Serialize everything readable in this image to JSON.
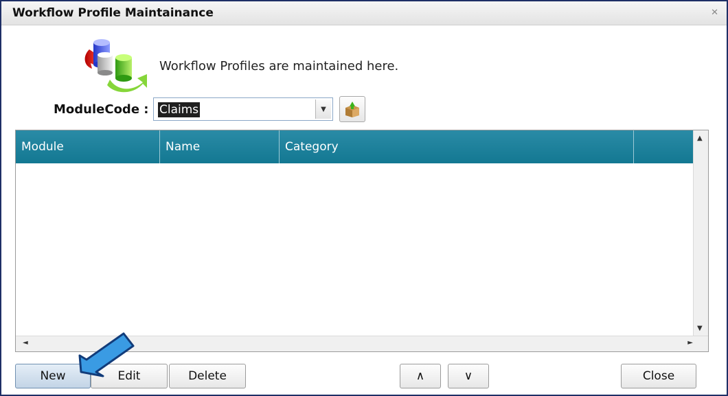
{
  "window": {
    "title": "Workflow Profile Maintainance",
    "close_glyph": "✕"
  },
  "header": {
    "description": "Workflow Profiles are maintained here.",
    "logo_icon": "database-sync-icon"
  },
  "module_code": {
    "label": "ModuleCode :",
    "value": "Claims",
    "dropdown_glyph": "▼",
    "action_icon": "box-upload-icon"
  },
  "grid": {
    "columns": [
      "Module",
      "Name",
      "Category",
      ""
    ],
    "rows": [],
    "header_color": "#1a819c",
    "scroll": {
      "up": "▲",
      "down": "▼",
      "left": "◄",
      "right": "►"
    }
  },
  "buttons": {
    "new": "New",
    "edit": "Edit",
    "delete": "Delete",
    "move_up": "∧",
    "move_down": "∨",
    "close": "Close"
  },
  "annotation": {
    "icon": "pointer-arrow-icon",
    "color": "#3a9be3"
  }
}
